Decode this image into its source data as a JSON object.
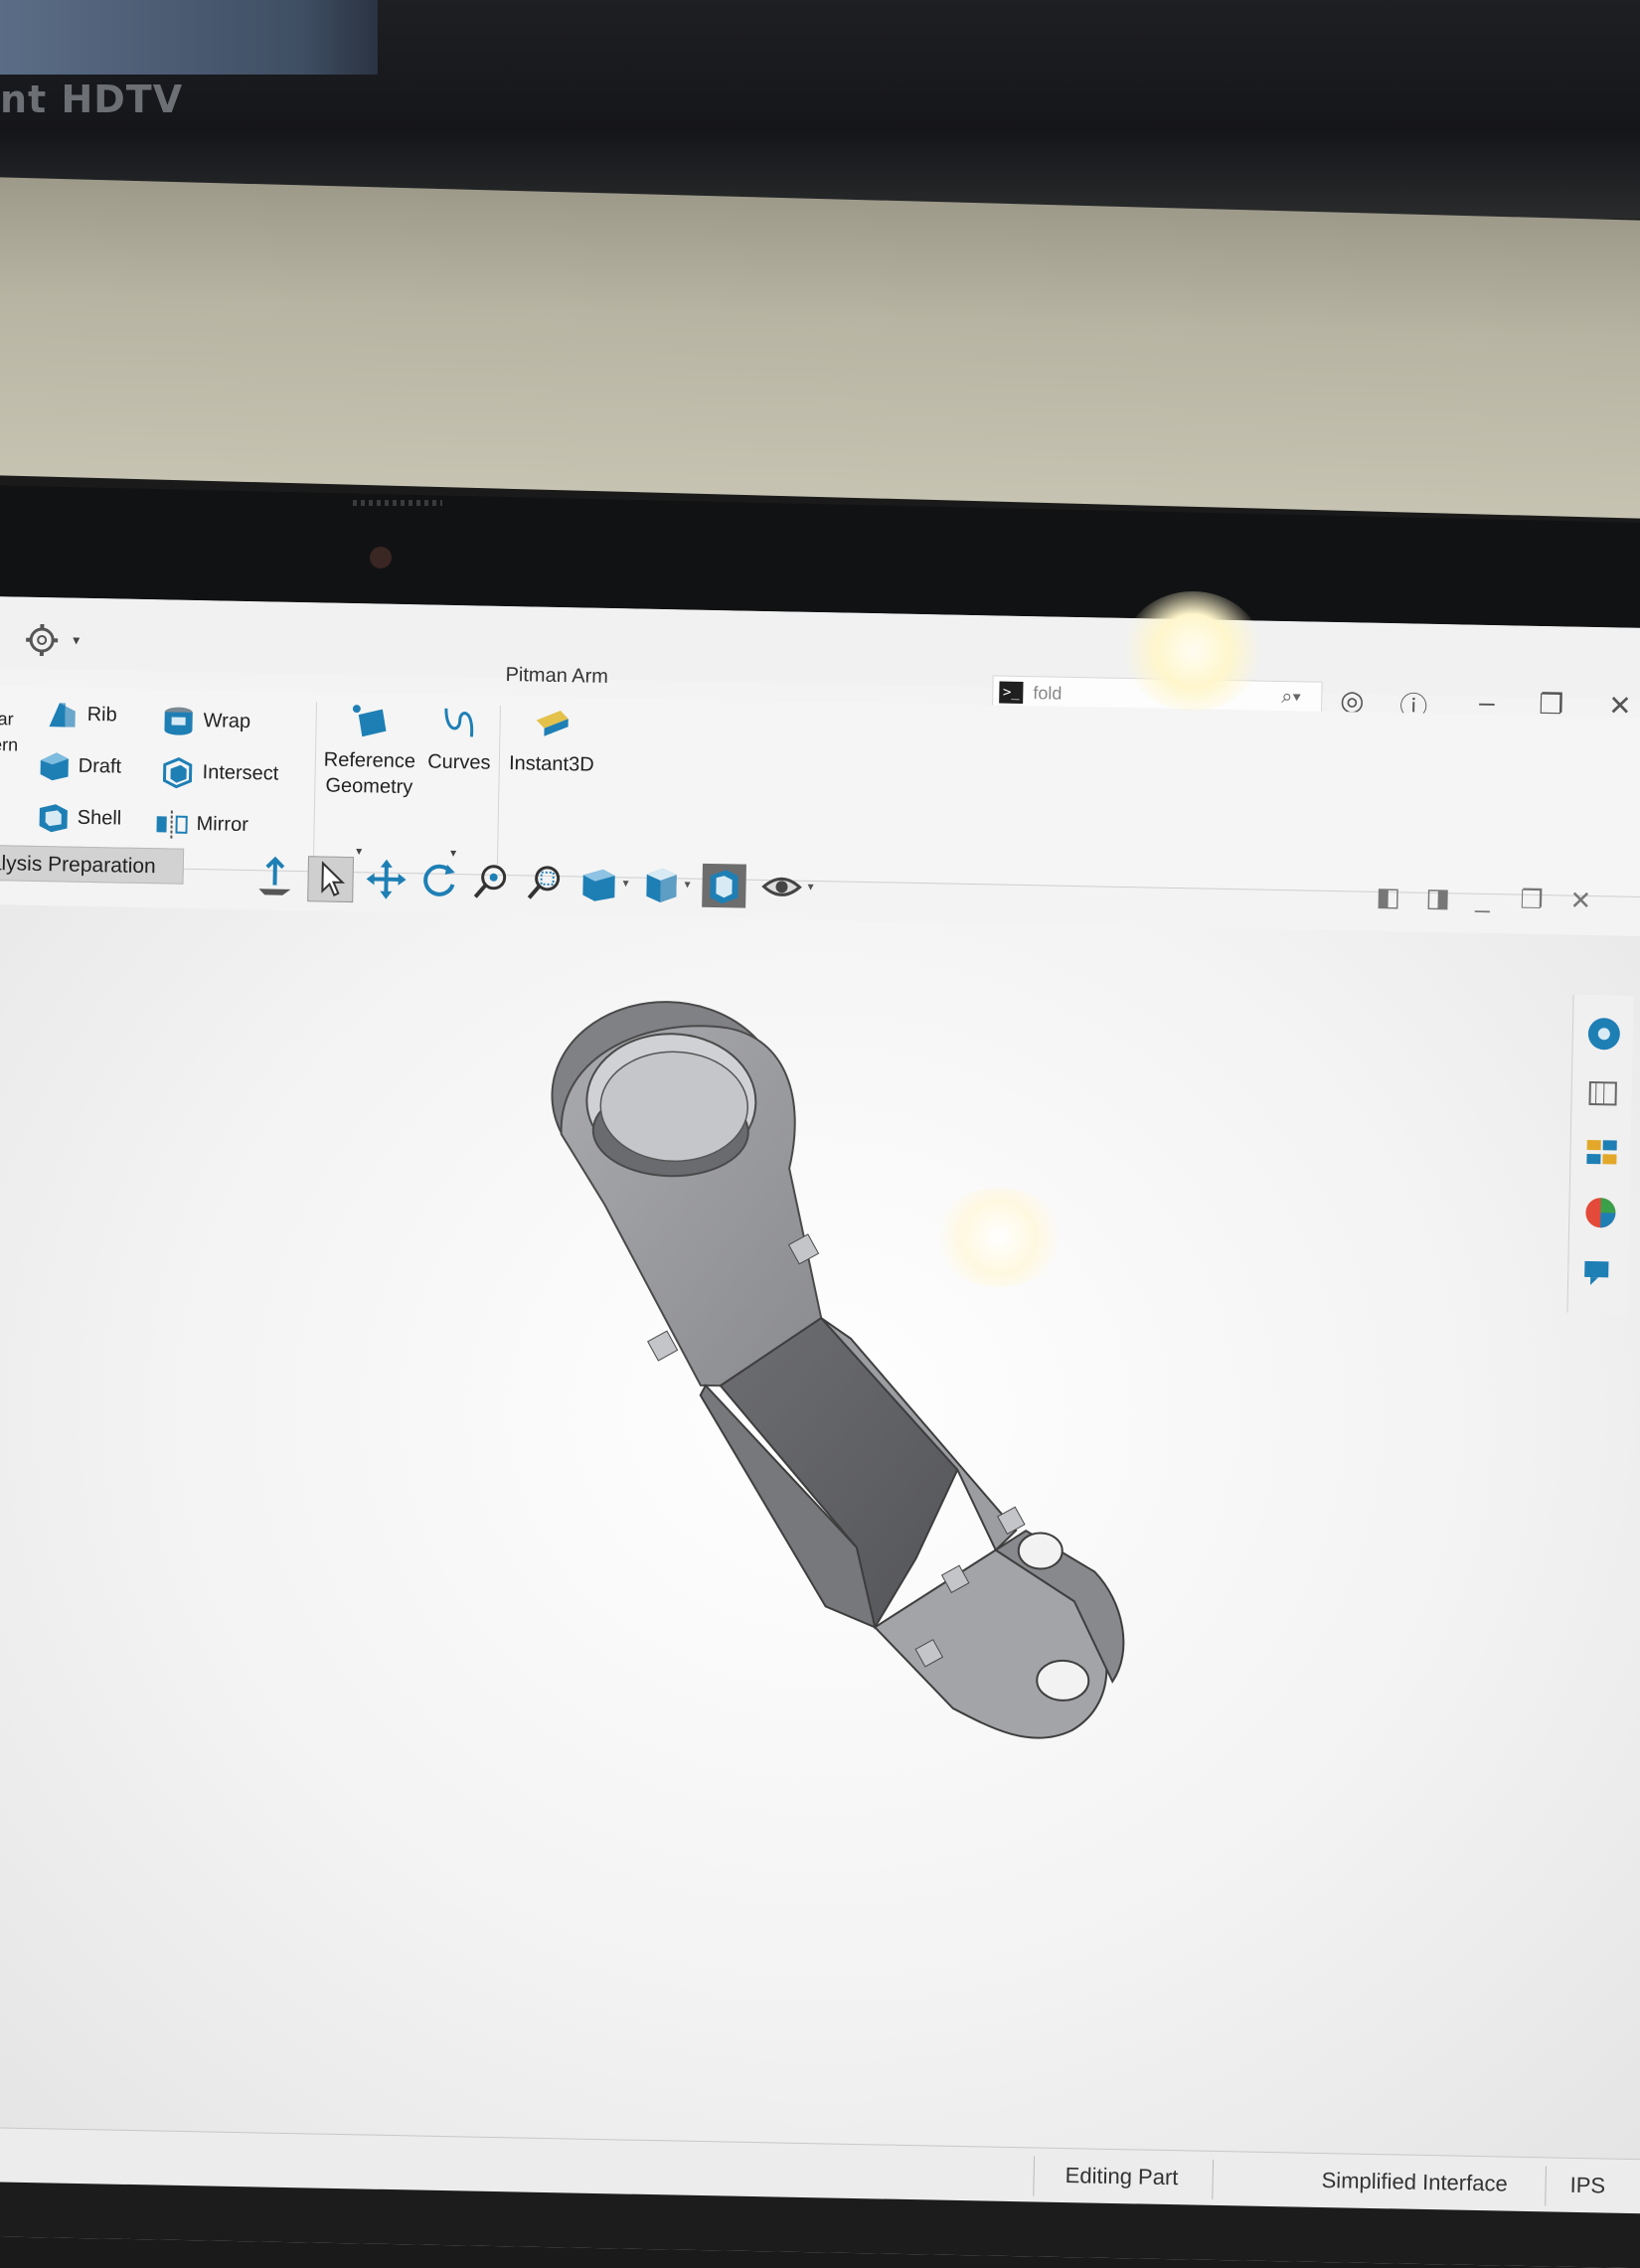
{
  "scene": {
    "tv_brand": "HDTV"
  },
  "window": {
    "title": "Pitman Arm"
  },
  "search": {
    "value": "fold",
    "prompt_glyph": ">_"
  },
  "ribbon": {
    "rib_label": "Rib",
    "draft_label": "Draft",
    "shell_label": "Shell",
    "wrap_label": "Wrap",
    "intersect_label": "Intersect",
    "mirror_label": "Mirror",
    "linear_pattern_partial_1": "ear",
    "linear_pattern_partial_2": "tern",
    "reference_geometry_line1": "Reference",
    "reference_geometry_line2": "Geometry",
    "curves_label": "Curves",
    "instant3d_label": "Instant3D"
  },
  "tabs": {
    "analysis_preparation": "alysis Preparation"
  },
  "status_bar": {
    "editing": "Editing Part",
    "interface": "Simplified Interface",
    "units": "IPS"
  },
  "colors": {
    "accent": "#1e7fb5",
    "part_gray": "#8c8d91",
    "viewport_bg": "#f4f4f4"
  }
}
